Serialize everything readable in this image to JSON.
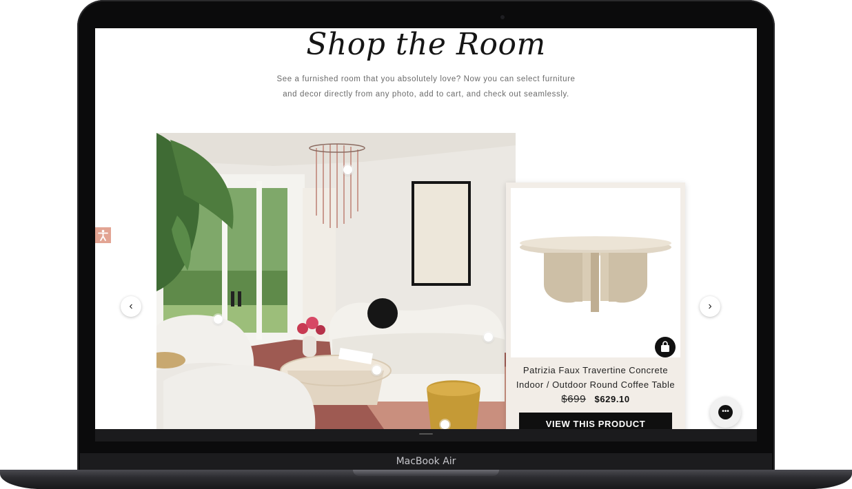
{
  "device": {
    "brand_label": "MacBook Air"
  },
  "section": {
    "title": "Shop the Room",
    "subtitle_line1": "See a furnished room that you absolutely love? Now you can select furniture",
    "subtitle_line2": "and decor directly from any photo, add to cart, and check out seamlessly."
  },
  "carousel": {
    "prev_icon": "chevron-left-icon",
    "next_icon": "chevron-right-icon",
    "prev_glyph": "‹",
    "next_glyph": "›"
  },
  "product_card": {
    "name_line1": "Patrizia Faux Travertine Concrete",
    "name_line2": "Indoor / Outdoor Round Coffee Table",
    "original_price": "$699",
    "sale_price": "$629.10",
    "cta_label": "VIEW THIS PRODUCT",
    "bag_icon": "shopping-bag-icon"
  },
  "widgets": {
    "accessibility_icon": "accessibility-icon",
    "chat_icon": "chat-icon",
    "chat_glyph": "•••"
  },
  "colors": {
    "accent": "#e2a493",
    "cta": "#0f0f0f",
    "card_bg": "#f2ede7"
  }
}
